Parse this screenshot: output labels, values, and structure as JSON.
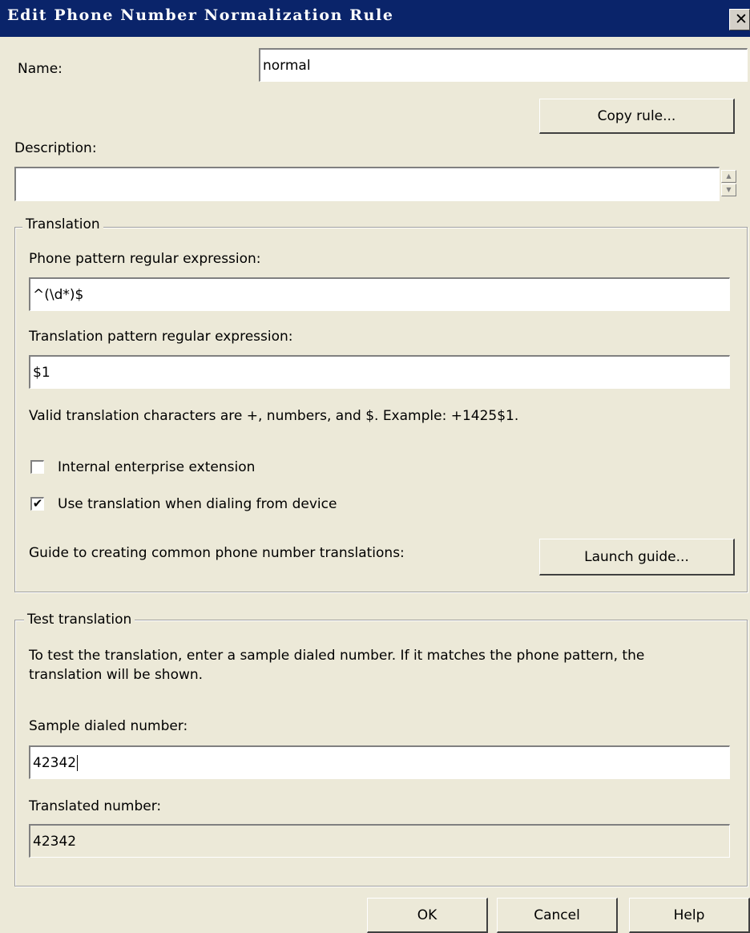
{
  "window": {
    "title": "Edit Phone Number Normalization Rule",
    "close_glyph": "✕"
  },
  "name": {
    "label": "Name:",
    "value": "normal"
  },
  "copy_rule_button": "Copy rule...",
  "description": {
    "label": "Description:",
    "value": ""
  },
  "translation": {
    "legend": "Translation",
    "phone_pattern_label": "Phone pattern regular expression:",
    "phone_pattern_value": "^(\\d*)$",
    "translation_pattern_label": "Translation pattern regular expression:",
    "translation_pattern_value": "$1",
    "hint": "Valid translation characters are +, numbers, and $. Example: +1425$1.",
    "internal_extension_label": "Internal enterprise extension",
    "internal_extension_checked": false,
    "use_translation_label": "Use translation when dialing from device",
    "use_translation_checked": true,
    "checkmark": "✔",
    "guide_label": "Guide to creating common phone number translations:",
    "launch_guide_button": "Launch guide..."
  },
  "test": {
    "legend": "Test translation",
    "instructions_line1": "To test the translation, enter a sample dialed number. If it matches the phone pattern, the",
    "instructions_line2": "translation will be shown.",
    "sample_label": "Sample dialed number:",
    "sample_value": "42342",
    "translated_label": "Translated number:",
    "translated_value": "42342"
  },
  "footer": {
    "ok": "OK",
    "cancel": "Cancel",
    "help": "Help"
  },
  "spinner": {
    "up": "▲",
    "down": "▼"
  }
}
